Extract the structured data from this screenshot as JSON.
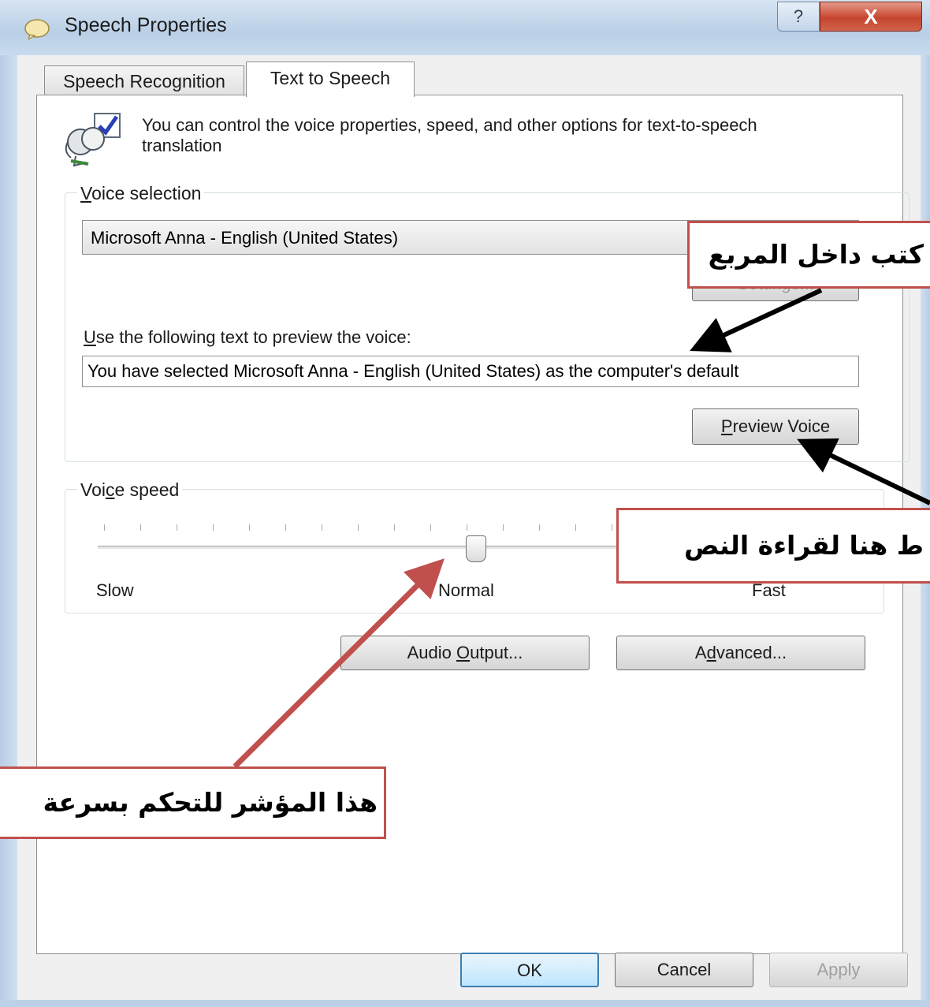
{
  "window": {
    "title": "Speech Properties",
    "help_glyph": "?",
    "close_glyph": "X",
    "buttons": {
      "ok": "OK",
      "cancel": "Cancel",
      "apply": "Apply"
    }
  },
  "tabs": [
    {
      "label": "Speech Recognition",
      "active": false
    },
    {
      "label": "Text to Speech",
      "active": true
    }
  ],
  "header": {
    "description": "You can control the voice properties, speed, and other options for text-to-speech translation"
  },
  "voice_selection": {
    "group_label_mnemonic": "V",
    "group_label_rest": "oice selection",
    "selected_voice": "Microsoft Anna - English (United States)",
    "settings_button": "Settings..."
  },
  "preview": {
    "label_mnemonic": "U",
    "label_rest": "se the following text to preview the voice:",
    "text": "You have selected Microsoft Anna - English (United States) as the computer's default",
    "button_mnemonic": "P",
    "button_rest": "review Voice"
  },
  "voice_speed": {
    "group_label_pre": "Voi",
    "group_label_mnemonic": "c",
    "group_label_post": "e speed",
    "slow": "Slow",
    "normal": "Normal",
    "fast": "Fast",
    "level": 0.5
  },
  "actions": {
    "audio_output_pre": "Audio ",
    "audio_output_mnemonic": "O",
    "audio_output_post": "utput...",
    "advanced_pre": "A",
    "advanced_mnemonic": "d",
    "advanced_post": "vanced..."
  },
  "annotations": {
    "type_in_box": "كتب داخل المربع",
    "click_to_read": "ط هنا لقراءة النص",
    "speed_pointer": "هذا المؤشر للتحكم بسرعة"
  },
  "colors": {
    "annotation_border": "#c0504d",
    "arrow_dark": "#000000",
    "arrow_red": "#c0504d",
    "close_button": "#c6452f"
  }
}
